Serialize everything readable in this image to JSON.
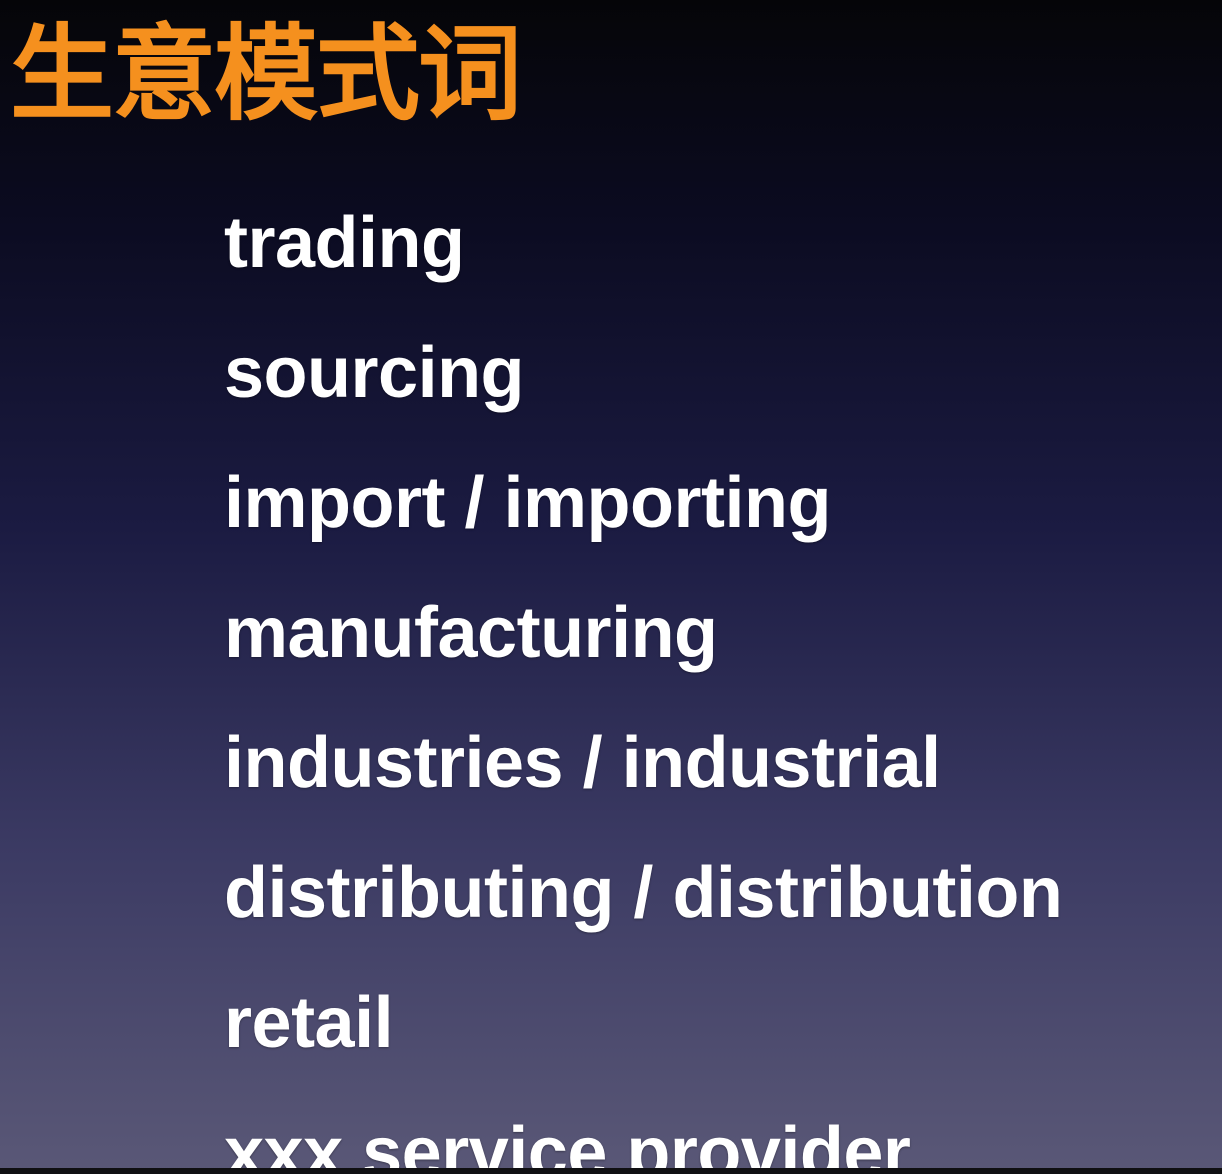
{
  "slide": {
    "title": "生意模式词",
    "terms": [
      "trading",
      "sourcing",
      "import / importing",
      "manufacturing",
      "industries / industrial",
      "distributing / distribution",
      "retail",
      "xxx service provider"
    ]
  },
  "colors": {
    "title": "#f5901e",
    "text": "#ffffff",
    "background_top": "#050508",
    "background_bottom": "#5a5877"
  }
}
